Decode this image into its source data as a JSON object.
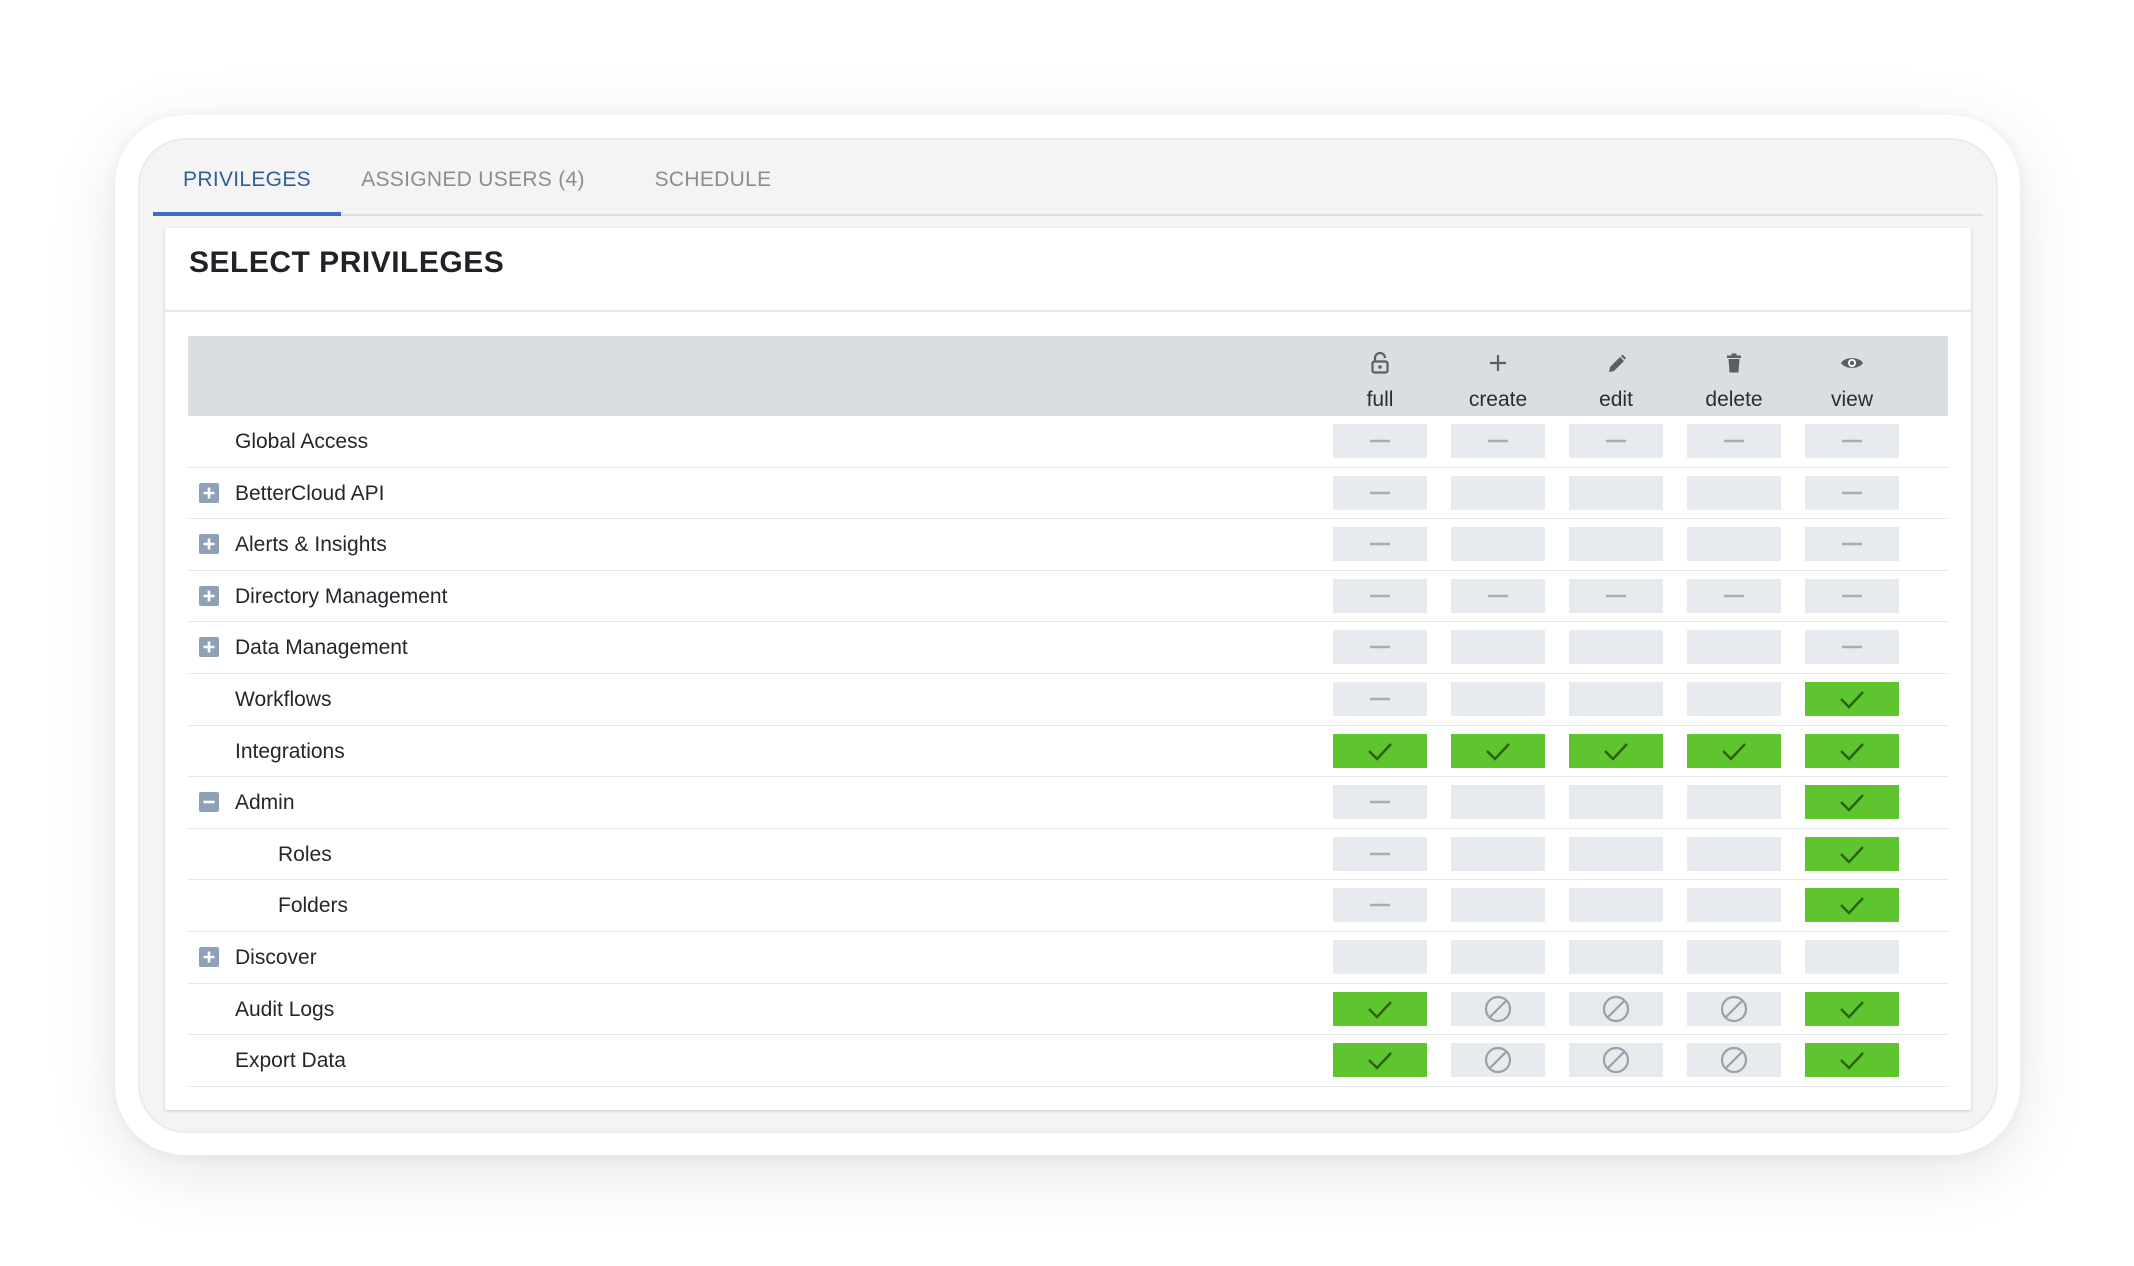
{
  "tabs": [
    {
      "label": "PRIVILEGES",
      "active": true
    },
    {
      "label": "ASSIGNED USERS (4)",
      "active": false
    },
    {
      "label": "SCHEDULE",
      "active": false
    }
  ],
  "panel": {
    "title": "SELECT PRIVILEGES"
  },
  "columns": [
    {
      "key": "full",
      "label": "full",
      "icon": "lock-open-icon"
    },
    {
      "key": "create",
      "label": "create",
      "icon": "plus-icon"
    },
    {
      "key": "edit",
      "label": "edit",
      "icon": "pencil-icon"
    },
    {
      "key": "delete",
      "label": "delete",
      "icon": "trash-icon"
    },
    {
      "key": "view",
      "label": "view",
      "icon": "eye-icon"
    }
  ],
  "state_legend": {
    "checked": "check-icon",
    "partial": "dash-icon",
    "empty": "none",
    "disabled": "blocked-icon"
  },
  "colors": {
    "checked": "#5fc52f",
    "cell": "#e7eaee",
    "header": "#d9dee3",
    "active_tab": "#3f6cc4",
    "expander": "#8fa1b6"
  },
  "rows": [
    {
      "label": "Global Access",
      "toggle": "none",
      "indent": 0,
      "cells": [
        "partial",
        "partial",
        "partial",
        "partial",
        "partial"
      ]
    },
    {
      "label": "BetterCloud API",
      "toggle": "expand",
      "indent": 0,
      "cells": [
        "partial",
        "empty",
        "empty",
        "empty",
        "partial"
      ]
    },
    {
      "label": "Alerts & Insights",
      "toggle": "expand",
      "indent": 0,
      "cells": [
        "partial",
        "empty",
        "empty",
        "empty",
        "partial"
      ]
    },
    {
      "label": "Directory Management",
      "toggle": "expand",
      "indent": 0,
      "cells": [
        "partial",
        "partial",
        "partial",
        "partial",
        "partial"
      ]
    },
    {
      "label": "Data Management",
      "toggle": "expand",
      "indent": 0,
      "cells": [
        "partial",
        "empty",
        "empty",
        "empty",
        "partial"
      ]
    },
    {
      "label": "Workflows",
      "toggle": "none",
      "indent": 0,
      "cells": [
        "partial",
        "empty",
        "empty",
        "empty",
        "checked"
      ]
    },
    {
      "label": "Integrations",
      "toggle": "none",
      "indent": 0,
      "cells": [
        "checked",
        "checked",
        "checked",
        "checked",
        "checked"
      ]
    },
    {
      "label": "Admin",
      "toggle": "collapse",
      "indent": 0,
      "cells": [
        "partial",
        "empty",
        "empty",
        "empty",
        "checked"
      ]
    },
    {
      "label": "Roles",
      "toggle": "none",
      "indent": 1,
      "cells": [
        "partial",
        "empty",
        "empty",
        "empty",
        "checked"
      ]
    },
    {
      "label": "Folders",
      "toggle": "none",
      "indent": 1,
      "cells": [
        "partial",
        "empty",
        "empty",
        "empty",
        "checked"
      ]
    },
    {
      "label": "Discover",
      "toggle": "expand",
      "indent": 0,
      "cells": [
        "empty",
        "empty",
        "empty",
        "empty",
        "empty"
      ]
    },
    {
      "label": "Audit Logs",
      "toggle": "none",
      "indent": 0,
      "cells": [
        "checked",
        "disabled",
        "disabled",
        "disabled",
        "checked"
      ]
    },
    {
      "label": "Export Data",
      "toggle": "none",
      "indent": 0,
      "cells": [
        "checked",
        "disabled",
        "disabled",
        "disabled",
        "checked"
      ]
    }
  ]
}
